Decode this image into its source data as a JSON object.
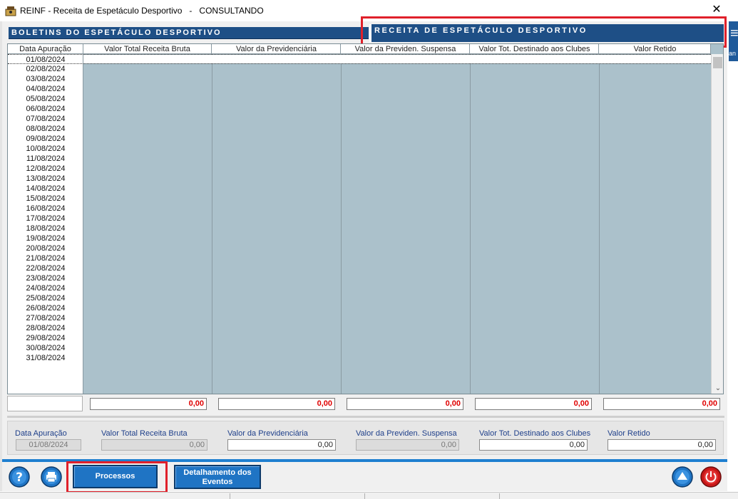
{
  "window": {
    "title": "REINF - Receita de Espetáculo Desportivo   -   CONSULTANDO",
    "close_glyph": "✕"
  },
  "side_strip": {
    "text": "an"
  },
  "headers": {
    "left": "BOLETINS DO ESPETÁCULO DESPORTIVO",
    "right": "RECEITA DE ESPETÁCULO DESPORTIVO"
  },
  "grid": {
    "columns": [
      "Data Apuração",
      "Valor Total Receita Bruta",
      "Valor da Previdenciária",
      "Valor da Previden. Suspensa",
      "Valor Tot. Destinado aos Clubes",
      "Valor Retido"
    ],
    "rows": [
      "01/08/2024",
      "02/08/2024",
      "03/08/2024",
      "04/08/2024",
      "05/08/2024",
      "06/08/2024",
      "07/08/2024",
      "08/08/2024",
      "09/08/2024",
      "10/08/2024",
      "11/08/2024",
      "12/08/2024",
      "13/08/2024",
      "14/08/2024",
      "15/08/2024",
      "16/08/2024",
      "17/08/2024",
      "18/08/2024",
      "19/08/2024",
      "20/08/2024",
      "21/08/2024",
      "22/08/2024",
      "23/08/2024",
      "24/08/2024",
      "25/08/2024",
      "26/08/2024",
      "27/08/2024",
      "28/08/2024",
      "29/08/2024",
      "30/08/2024",
      "31/08/2024"
    ],
    "selected_row": 0
  },
  "totals": [
    "0,00",
    "0,00",
    "0,00",
    "0,00",
    "0,00"
  ],
  "detail": {
    "fields": [
      {
        "label": "Data Apuração",
        "value": "01/08/2024"
      },
      {
        "label": "Valor Total Receita Bruta",
        "value": "0,00"
      },
      {
        "label": "Valor da Previdenciária",
        "value": "0,00"
      },
      {
        "label": "Valor da Previden. Suspensa",
        "value": "0,00"
      },
      {
        "label": "Valor Tot. Destinado aos Clubes",
        "value": "0,00"
      },
      {
        "label": "Valor Retido",
        "value": "0,00"
      }
    ]
  },
  "buttons": {
    "processos": "Processos",
    "detalhamento_line1": "Detalhamento dos",
    "detalhamento_line2": "Eventos"
  },
  "icons": {
    "help": "help-icon",
    "print": "printer-icon",
    "up": "arrow-up-icon",
    "power": "power-icon"
  },
  "colors": {
    "header_blue": "#1e4f86",
    "grid_bg": "#abc1cb",
    "total_red": "#e00000",
    "highlight_red": "#e0202a",
    "button_blue": "#1f74c4"
  }
}
